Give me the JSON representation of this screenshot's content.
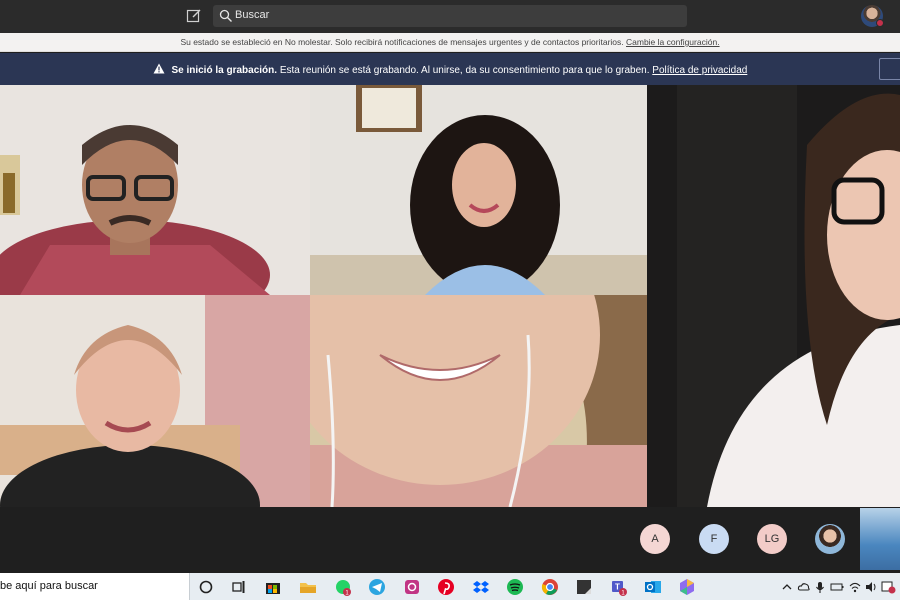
{
  "titlebar": {
    "search_placeholder": "Buscar"
  },
  "dnd_banner": {
    "message": "Su estado se estableció en No molestar. Solo recibirá notificaciones de mensajes urgentes y de contactos prioritarios.",
    "link": "Cambie la configuración."
  },
  "recording_banner": {
    "title": "Se inició la grabación.",
    "message": "Esta reunión se está grabando. Al unirse, da su consentimiento para que lo graben.",
    "link": "Política de privacidad"
  },
  "participants": {
    "avatars": [
      "A",
      "F",
      "LG"
    ]
  },
  "taskbar": {
    "search_text": "be aquí para buscar",
    "badges": {
      "whatsapp": "1",
      "teams": "1"
    }
  },
  "colors": {
    "banner": "#2b3654",
    "titlebar": "#2b2b2b",
    "badge": "#c4314b"
  }
}
